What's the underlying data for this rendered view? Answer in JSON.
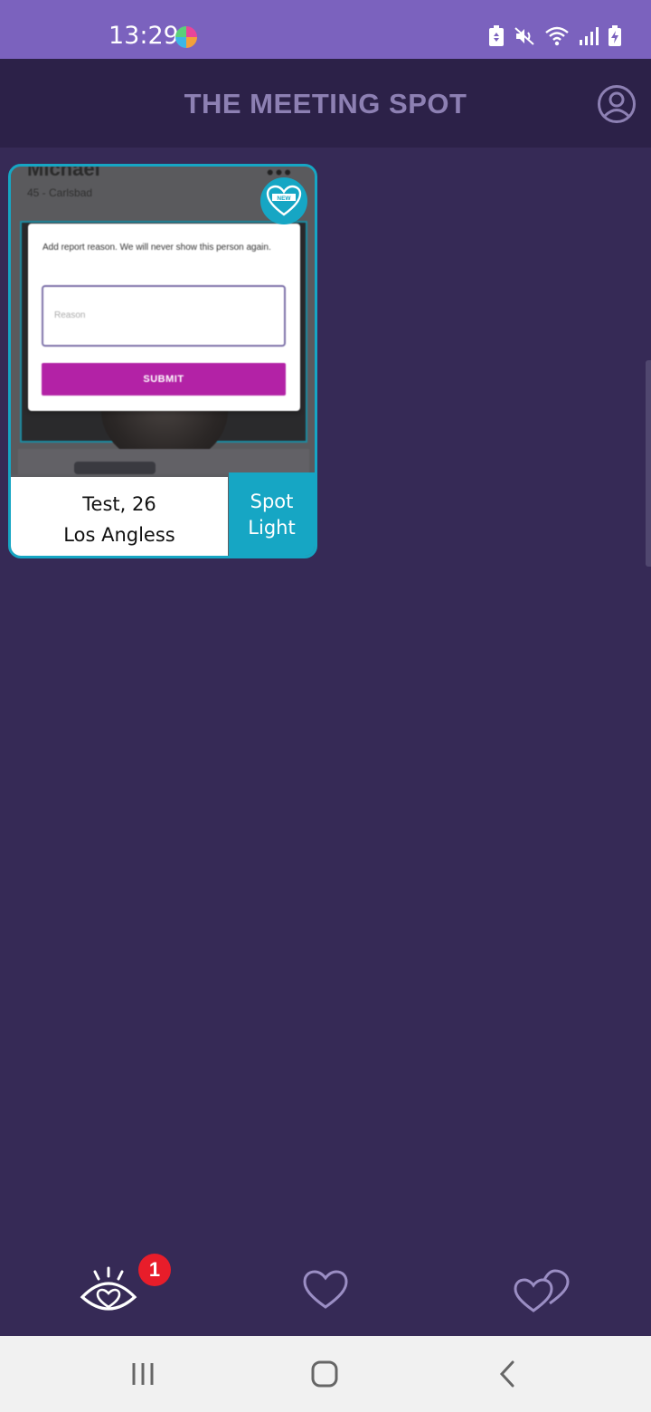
{
  "status_bar": {
    "time": "13:29",
    "icons": [
      "app-icon",
      "battery-saver-icon",
      "mute-icon",
      "wifi-icon",
      "signal-icon",
      "battery-charging-icon"
    ]
  },
  "app_bar": {
    "title": "THE MEETING SPOT",
    "profile_icon": "account-circle-icon"
  },
  "card": {
    "screenshot": {
      "person_name": "Michael",
      "person_sub": "45 - Carlsbad",
      "dialog": {
        "message": "Add report reason. We will never show this person again.",
        "reason_placeholder": "Reason",
        "submit_label": "SUBMIT"
      }
    },
    "new_badge_label": "NEW",
    "info_line1": "Test, 26",
    "info_line2": "Los Angless",
    "spotlight_line1": "Spot",
    "spotlight_line2": "Light"
  },
  "tab_bar": {
    "tabs": [
      {
        "name": "watch",
        "icon": "eye-heart-icon",
        "badge": "1",
        "active": true
      },
      {
        "name": "likes",
        "icon": "heart-icon",
        "active": false
      },
      {
        "name": "matches",
        "icon": "double-heart-icon",
        "active": false
      }
    ]
  },
  "nav_bar": {
    "buttons": [
      "recents-icon",
      "home-icon",
      "back-icon"
    ]
  },
  "colors": {
    "status_bar": "#7b62be",
    "app_bar": "#2c2148",
    "background": "#362a56",
    "accent": "#16a6c4",
    "submit": "#b322a6",
    "badge": "#e81d2a"
  }
}
